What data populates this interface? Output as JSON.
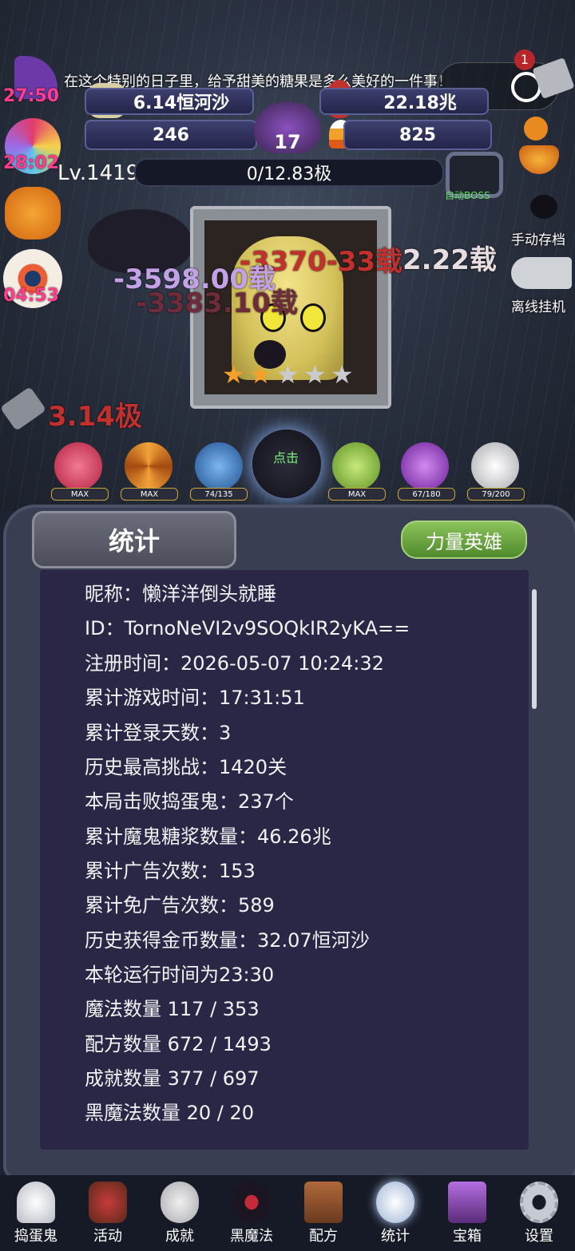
{
  "banner": "在这个特别的日子里，给予甜美的糖果是多么美好的一件事！",
  "resources": {
    "gold": "6.14恒河沙",
    "syrup": "22.18兆",
    "skulls": "246",
    "cauldron": "17",
    "candy": "825"
  },
  "timers": [
    "27:50",
    "28:02",
    "04:53"
  ],
  "level": {
    "label": "Lv.1419",
    "progress": "0/12.83极"
  },
  "auto_boss": "自动BOSS",
  "side_buttons": {
    "save": "手动存档",
    "offline": "离线挂机"
  },
  "notification_count": "1",
  "tap_label": "点击",
  "damage_texts": [
    "-3370-33载",
    "2.22载",
    "-3598.00载",
    "-3383.10载",
    "3.14极"
  ],
  "heroes": [
    {
      "name": "red-skull",
      "level": "MAX",
      "color": "#d33a5a"
    },
    {
      "name": "orange-swirl",
      "level": "MAX",
      "color": "#e38a2a"
    },
    {
      "name": "blue-spider",
      "level": "74/135",
      "color": "#2f6fb8"
    },
    {
      "name": "green-spider",
      "level": "MAX",
      "color": "#8fc43a"
    },
    {
      "name": "purple-skull",
      "level": "67/180",
      "color": "#9b42c9"
    },
    {
      "name": "white-skull",
      "level": "79/200",
      "color": "#e6e6e6"
    }
  ],
  "panel": {
    "title": "统计",
    "hero_button": "力量英雄"
  },
  "stats": [
    "昵称：懒洋洋倒头就睡",
    "ID：TornoNeVI2v9SOQkIR2yKA==",
    "注册时间：2026-05-07 10:24:32",
    "累计游戏时间：17:31:51",
    "累计登录天数：3",
    "历史最高挑战：1420关",
    "本局击败捣蛋鬼：237个",
    "累计魔鬼糖浆数量：46.26兆",
    "累计广告次数：153",
    "累计免广告次数：589",
    "历史获得金币数量：32.07恒河沙",
    "本轮运行时间为23:30",
    "魔法数量 117 / 353",
    "配方数量 672 / 1493",
    "成就数量 377 / 697",
    "黑魔法数量 20 / 20"
  ],
  "nav": [
    "捣蛋鬼",
    "活动",
    "成就",
    "黑魔法",
    "配方",
    "统计",
    "宝箱",
    "设置"
  ]
}
